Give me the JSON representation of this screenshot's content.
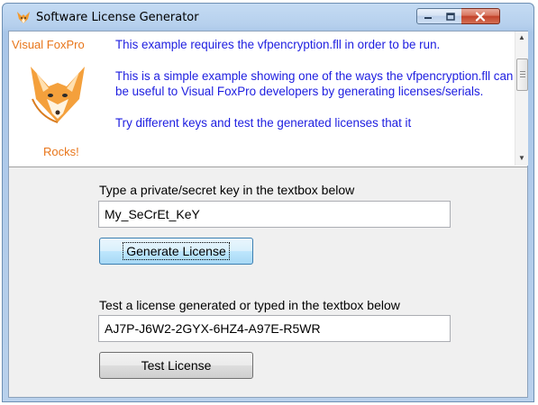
{
  "window": {
    "title": "Software License Generator",
    "icon": "fox-icon",
    "controls": {
      "minimize": "minimize-icon",
      "maximize": "maximize-icon",
      "close": "close-icon"
    }
  },
  "info": {
    "brand_top": "Visual FoxPro",
    "brand_bottom": "Rocks!",
    "paragraphs": [
      "This example requires the vfpencryption.fll in order to be run.",
      "This is a simple example showing one of the ways the vfpencryption.fll can be useful to Visual FoxPro developers by generating licenses/serials.",
      "Try different keys and test the generated licenses that it"
    ]
  },
  "form": {
    "key_label": "Type a private/secret key in the textbox below",
    "key_value": "My_SeCrEt_KeY",
    "generate_label": "Generate License",
    "test_label_text": "Test a license generated or typed in the textbox below",
    "license_value": "AJ7P-J6W2-2GYX-6HZ4-A97E-R5WR",
    "test_button_label": "Test License"
  },
  "colors": {
    "info_text": "#1d1de0",
    "brand": "#e8761b"
  }
}
